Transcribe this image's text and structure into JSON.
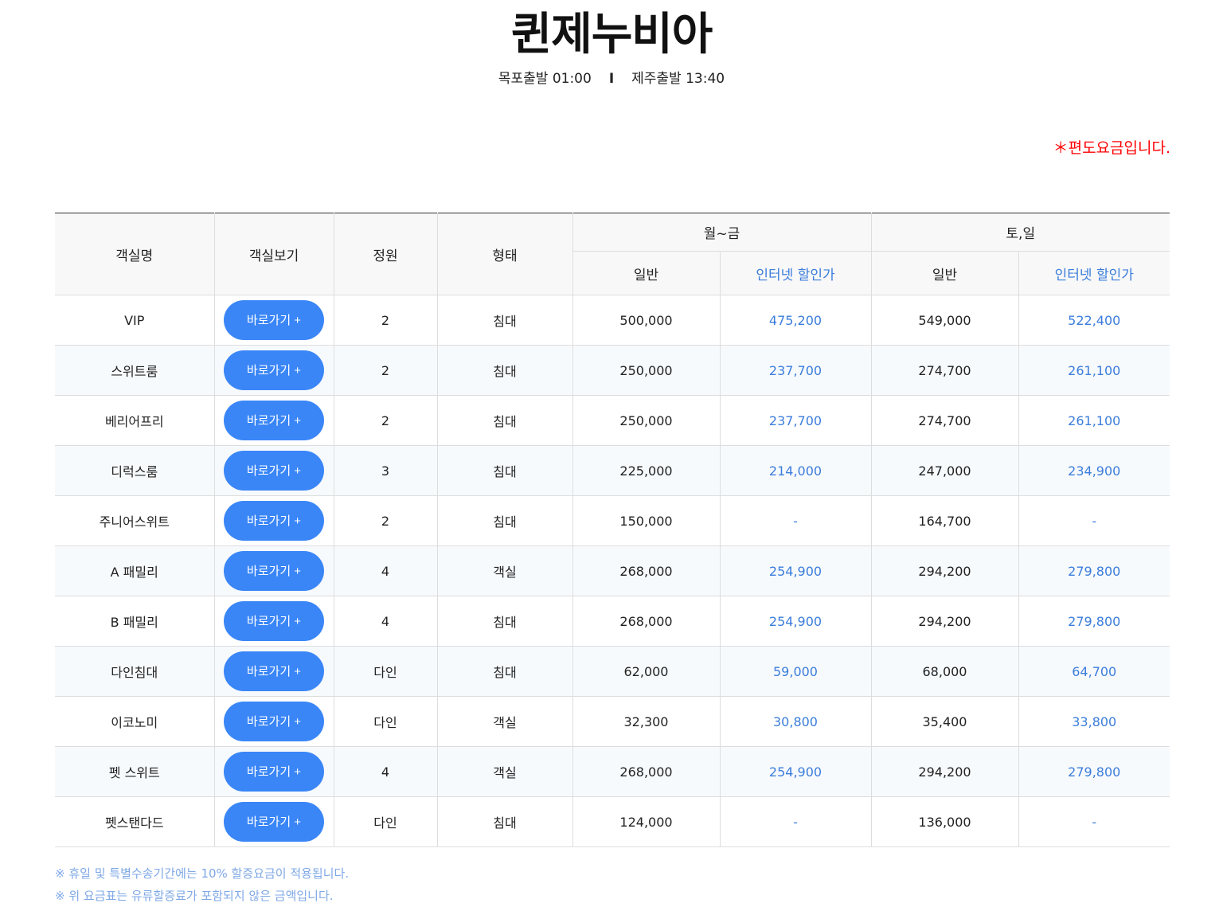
{
  "title": "퀸제누비아",
  "departures": {
    "mokpo": "목포출발 01:00",
    "separator": "I",
    "jeju": "제주출발 13:40"
  },
  "notice": "＊편도요금입니다.",
  "table": {
    "headers": {
      "room_name": "객실명",
      "room_view": "객실보기",
      "capacity": "정원",
      "type": "형태",
      "weekday": "월~금",
      "weekend": "토,일",
      "regular": "일반",
      "internet": "인터넷 할인가"
    },
    "rows": [
      {
        "name": "VIP",
        "button": "바로가기 +",
        "capacity": "2",
        "type": "침대",
        "wk_reg": "500,000",
        "wk_net": "475,200",
        "we_reg": "549,000",
        "we_net": "522,400"
      },
      {
        "name": "스위트룸",
        "button": "바로가기 +",
        "capacity": "2",
        "type": "침대",
        "wk_reg": "250,000",
        "wk_net": "237,700",
        "we_reg": "274,700",
        "we_net": "261,100"
      },
      {
        "name": "베리어프리",
        "button": "바로가기 +",
        "capacity": "2",
        "type": "침대",
        "wk_reg": "250,000",
        "wk_net": "237,700",
        "we_reg": "274,700",
        "we_net": "261,100"
      },
      {
        "name": "디럭스룸",
        "button": "바로가기 +",
        "capacity": "3",
        "type": "침대",
        "wk_reg": "225,000",
        "wk_net": "214,000",
        "we_reg": "247,000",
        "we_net": "234,900"
      },
      {
        "name": "주니어스위트",
        "button": "바로가기 +",
        "capacity": "2",
        "type": "침대",
        "wk_reg": "150,000",
        "wk_net": "-",
        "we_reg": "164,700",
        "we_net": "-"
      },
      {
        "name": "A 패밀리",
        "button": "바로가기 +",
        "capacity": "4",
        "type": "객실",
        "wk_reg": "268,000",
        "wk_net": "254,900",
        "we_reg": "294,200",
        "we_net": "279,800"
      },
      {
        "name": "B 패밀리",
        "button": "바로가기 +",
        "capacity": "4",
        "type": "침대",
        "wk_reg": "268,000",
        "wk_net": "254,900",
        "we_reg": "294,200",
        "we_net": "279,800"
      },
      {
        "name": "다인침대",
        "button": "바로가기 +",
        "capacity": "다인",
        "type": "침대",
        "wk_reg": "62,000",
        "wk_net": "59,000",
        "we_reg": "68,000",
        "we_net": "64,700"
      },
      {
        "name": "이코노미",
        "button": "바로가기 +",
        "capacity": "다인",
        "type": "객실",
        "wk_reg": "32,300",
        "wk_net": "30,800",
        "we_reg": "35,400",
        "we_net": "33,800"
      },
      {
        "name": "펫 스위트",
        "button": "바로가기 +",
        "capacity": "4",
        "type": "객실",
        "wk_reg": "268,000",
        "wk_net": "254,900",
        "we_reg": "294,200",
        "we_net": "279,800"
      },
      {
        "name": "펫스탠다드",
        "button": "바로가기 +",
        "capacity": "다인",
        "type": "침대",
        "wk_reg": "124,000",
        "wk_net": "-",
        "we_reg": "136,000",
        "we_net": "-"
      }
    ]
  },
  "footnotes": [
    "※ 휴일 및 특별수송기간에는 10% 할증요금이 적용됩니다.",
    "※ 위 요금표는 유류할증료가 포함되지 않은 금액입니다."
  ],
  "colors": {
    "accent_blue": "#3a86f7",
    "discount_text": "#3b7ddb",
    "notice_red": "#ff0000"
  }
}
